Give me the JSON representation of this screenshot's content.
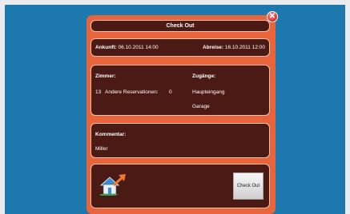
{
  "dialog": {
    "title": "Check Out",
    "close_glyph": "✕",
    "arrival_label": "Ankunft:",
    "arrival_value": "06.10.2011 14:00",
    "departure_label": "Abreise:",
    "departure_value": "16.10.2011 12:00",
    "rooms_label": "Zimmer:",
    "room_number": "13",
    "other_reservations_label": "Andere Reservationen:",
    "other_reservations_value": "0",
    "access_label": "Zugänge:",
    "access_items": [
      "Haupteingang",
      "Garage"
    ],
    "comment_label": "Kommentar:",
    "comment_value": "Miller",
    "checkout_button": "Check Out"
  },
  "icons": {
    "close": "close-icon",
    "house_exit": "house-exit-icon"
  },
  "colors": {
    "background": "#1d78ae",
    "dialog": "#e8643a",
    "panel": "#4b1a14"
  }
}
